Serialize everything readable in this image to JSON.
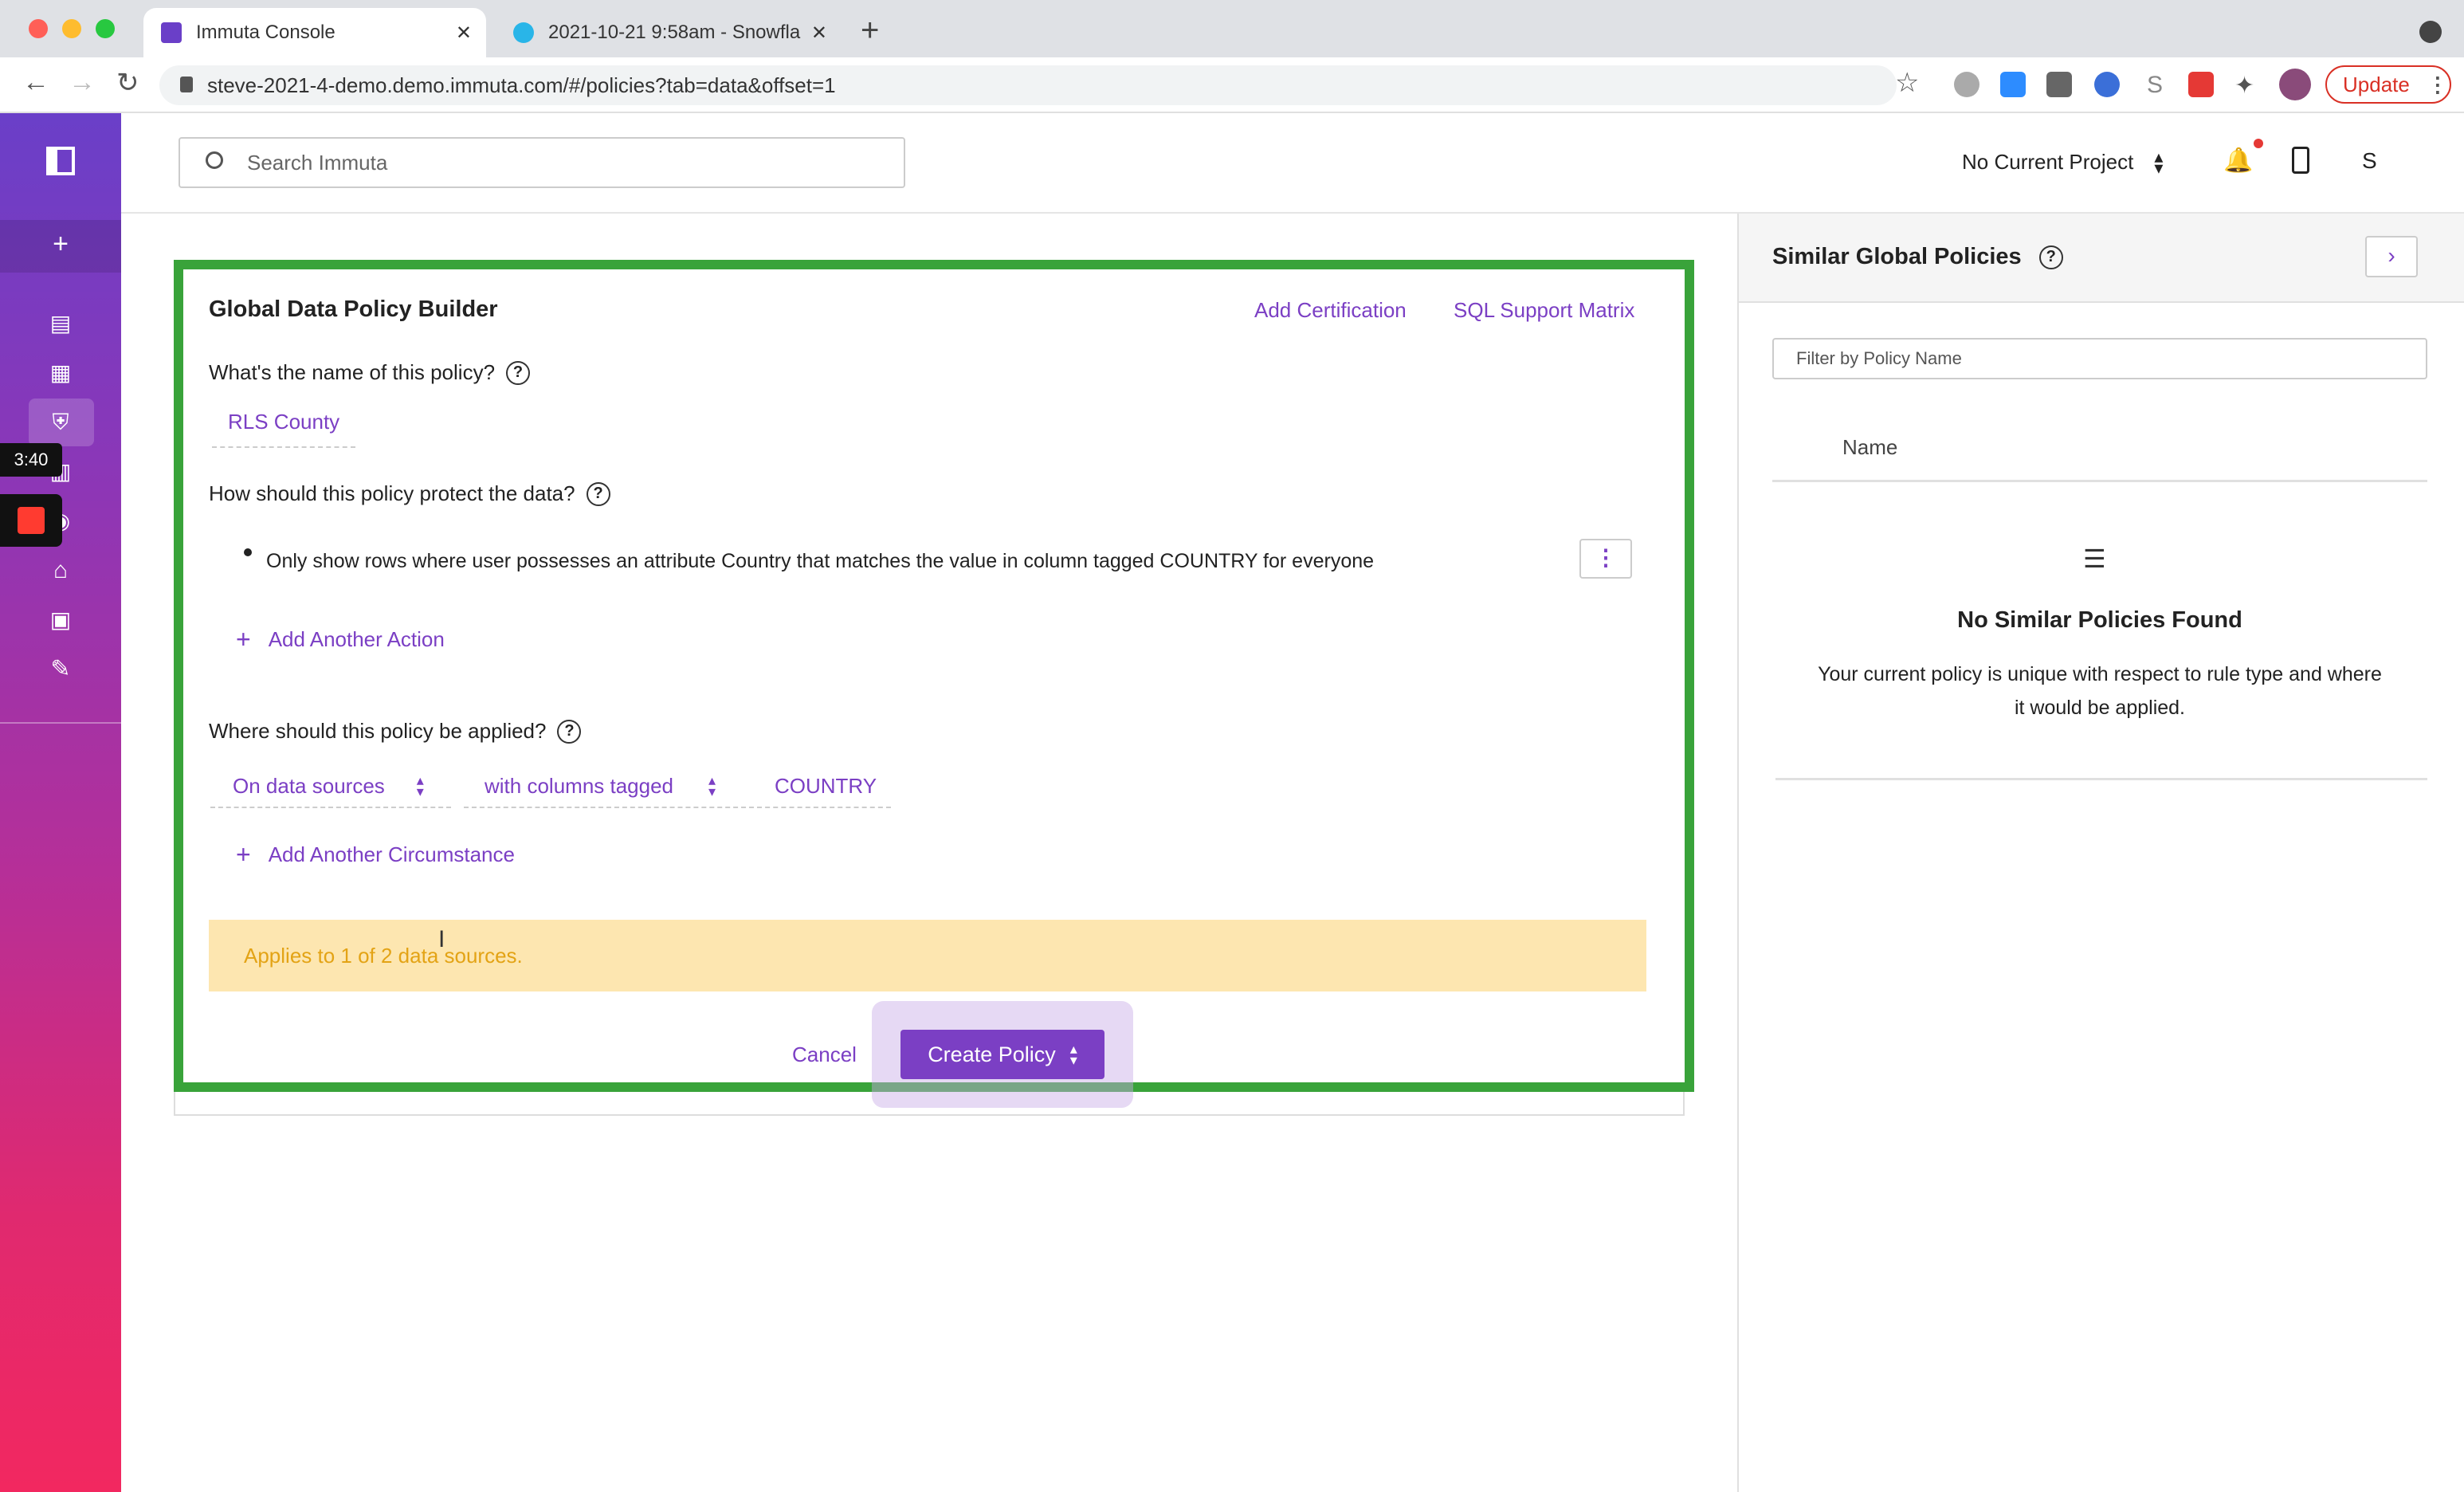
{
  "browser": {
    "tabs": [
      {
        "title": "Immuta Console"
      },
      {
        "title": "2021-10-21 9:58am - Snowfla"
      }
    ],
    "new_tab_symbol": "+",
    "close_symbol": "✕",
    "url": "steve-2021-4-demo.demo.immuta.com/#/policies?tab=data&offset=1",
    "update_label": "Update"
  },
  "recording": {
    "time": "3:40"
  },
  "header": {
    "search_placeholder": "Search Immuta",
    "project_label": "No Current Project",
    "user_initial": "S"
  },
  "builder": {
    "title": "Global Data Policy Builder",
    "add_certification": "Add Certification",
    "sql_support_matrix": "SQL Support Matrix",
    "name_question": "What's the name of this policy?",
    "name_value": "RLS County",
    "protect_question": "How should this policy protect the data?",
    "action_text": "Only show rows where user possesses an attribute Country that matches the value in column tagged COUNTRY for everyone",
    "add_action": "Add Another Action",
    "apply_question": "Where should this policy be applied?",
    "circumstance": {
      "scope": "On data sources",
      "condition": "with columns tagged",
      "tag": "COUNTRY"
    },
    "add_circumstance": "Add Another Circumstance",
    "applies_note": "Applies to 1 of 2 data sources.",
    "cancel_label": "Cancel",
    "create_label": "Create Policy"
  },
  "similar": {
    "title": "Similar Global Policies",
    "filter_placeholder": "Filter by Policy Name",
    "column_name": "Name",
    "empty_title": "No Similar Policies Found",
    "empty_line1": "Your current policy is unique with respect to rule type and where",
    "empty_line2": "it would be applied."
  },
  "colors": {
    "accent": "#7b3fc4",
    "highlight_border": "#39a33a",
    "warning_bg": "#fde6b0",
    "warning_text": "#e3a315"
  }
}
